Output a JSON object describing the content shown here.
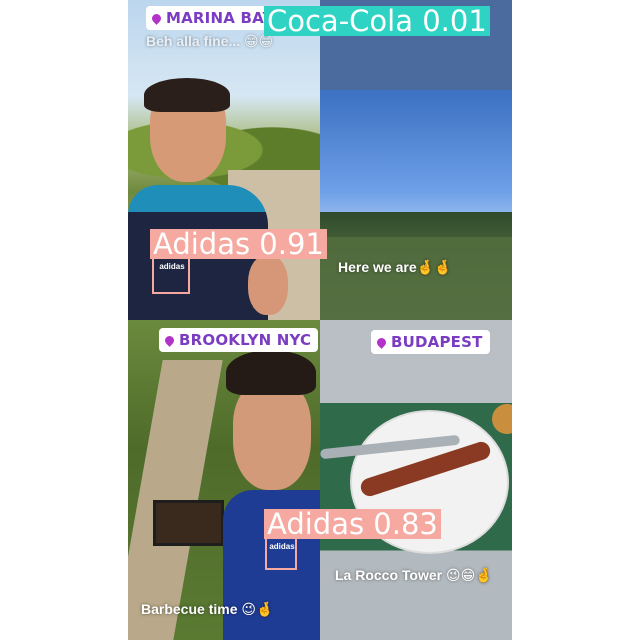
{
  "panels": {
    "top_left": {
      "sticker": "MARINA BAY SA",
      "caption": "Beh alla fine... 😁😁"
    },
    "top_right": {
      "caption": "Here we are🤞🤞"
    },
    "bottom_left": {
      "sticker": "BROOKLYN NYC",
      "caption": "Barbecue time 😉🤞"
    },
    "bottom_right": {
      "sticker": "BUDAPEST",
      "caption": "La Rocco Tower 😉😁🤞"
    }
  },
  "detections": [
    {
      "label": "Coca-Cola 0.01",
      "color": "#2ed3c4",
      "text_color": "#ffffff"
    },
    {
      "label": "Adidas 0.91",
      "color": "#f5a9a0",
      "text_color": "#ffffff"
    },
    {
      "label": "Adidas 0.83",
      "color": "#f5a9a0",
      "text_color": "#ffffff"
    }
  ],
  "logos": {
    "adidas": "adidas"
  },
  "icons": {
    "location_pin": "location-pin-icon"
  }
}
